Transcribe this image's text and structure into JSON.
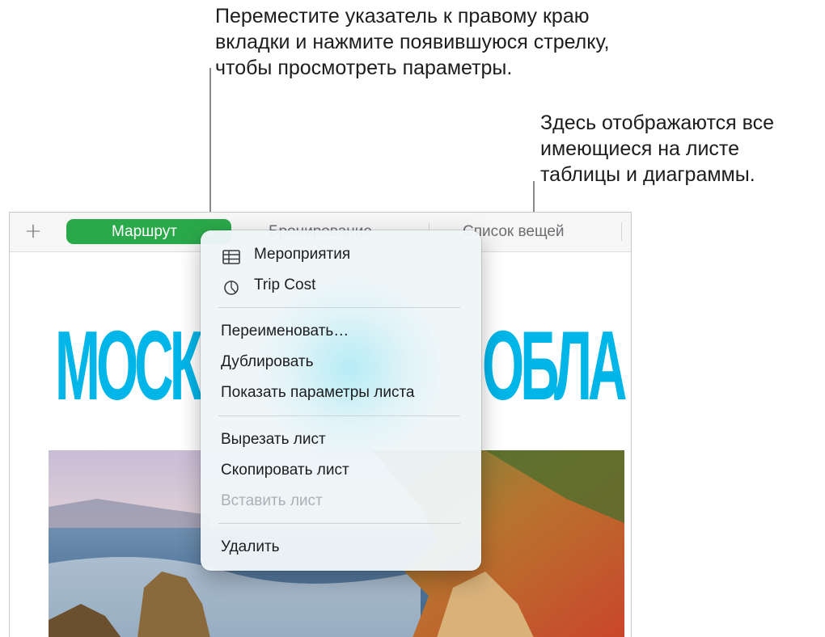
{
  "callouts": {
    "tab_arrow": "Переместите указатель к правому краю\nвкладки и нажмите появившуюся стрелку,\nчтобы просмотреть параметры.",
    "sheet_objects": "Здесь отображаются все\nимеющиеся на листе\nтаблицы и диаграммы."
  },
  "tab_bar": {
    "add_sheet_glyph": "+",
    "tabs": [
      {
        "label": "Маршрут",
        "active": true
      },
      {
        "label": "Бронирование",
        "active": false
      },
      {
        "label": "Список вещей",
        "active": false
      }
    ],
    "active_tab_chevron": "⌄"
  },
  "document": {
    "hero_left": "МОСК",
    "hero_right": "ОБЛА"
  },
  "context_menu": {
    "sheet_objects": [
      {
        "label": "Мероприятия",
        "icon": "table-icon"
      },
      {
        "label": "Trip Cost",
        "icon": "pie-chart-icon"
      }
    ],
    "actions": [
      {
        "label": "Переименовать…"
      },
      {
        "label": "Дублировать"
      },
      {
        "label": "Показать параметры листа"
      }
    ],
    "clipboard": [
      {
        "label": "Вырезать лист",
        "enabled": true
      },
      {
        "label": "Скопировать лист",
        "enabled": true
      },
      {
        "label": "Вставить лист",
        "enabled": false
      }
    ],
    "delete": {
      "label": "Удалить"
    }
  },
  "colors": {
    "active_tab": "#2aa94a",
    "hero_text": "#00b5e8",
    "menu_background": "#eff6f8",
    "disabled_text": "#a9b1b5"
  }
}
